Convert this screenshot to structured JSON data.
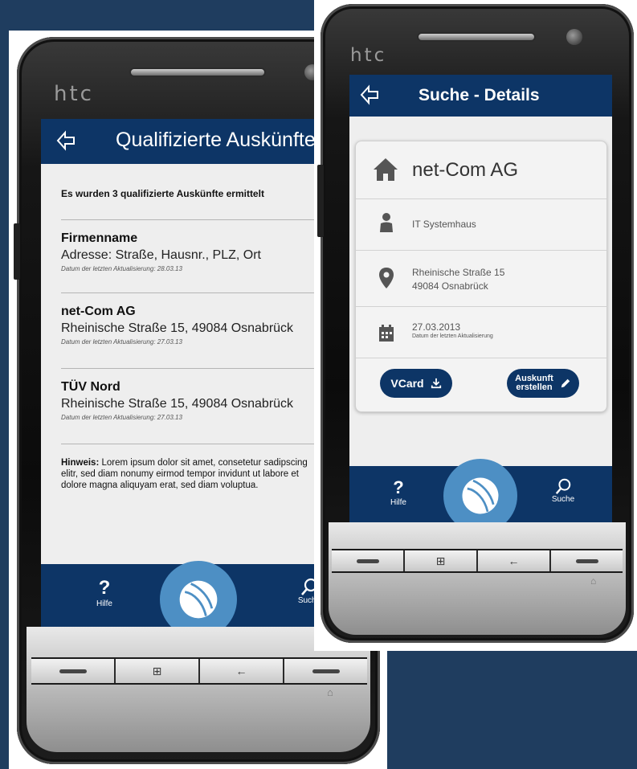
{
  "phone_left": {
    "brand": "htc",
    "screen": {
      "title": "Qualifizierte Auskünfte",
      "result_count": "Es wurden 3 qualifizierte Auskünfte ermittelt",
      "entries": [
        {
          "name": "Firmenname",
          "address": "Adresse: Straße, Hausnr., PLZ, Ort",
          "updated": "Datum der letzten Aktualisierung: 28.03.13"
        },
        {
          "name": "net-Com AG",
          "address": "Rheinische Straße 15, 49084 Osnabrück",
          "updated": "Datum der letzten Aktualisierung: 27.03.13"
        },
        {
          "name": "TÜV Nord",
          "address": "Rheinische Straße 15, 49084 Osnabrück",
          "updated": "Datum der letzten Aktualisierung: 27.03.13"
        }
      ],
      "hint_label": "Hinweis:",
      "hint_text": " Lorem ipsum dolor sit amet, consetetur sadipscing elitr, sed diam nonumy eirmod tempor invidunt ut labore et dolore magna aliquyam erat, sed diam voluptua.",
      "nav_help": "Hilfe",
      "nav_help_glyph": "?",
      "nav_search": "Suche"
    }
  },
  "phone_right": {
    "brand": "htc",
    "screen": {
      "title": "Suche - Details",
      "company": "net-Com AG",
      "category": "IT Systemhaus",
      "street": "Rheinische Straße 15",
      "city": "49084 Osnabrück",
      "date": "27.03.2013",
      "date_caption": "Datum der letzten Aktualisierung",
      "vcard_label": "VCard",
      "request_label_1": "Auskunft",
      "request_label_2": "erstellen",
      "nav_help": "Hilfe",
      "nav_help_glyph": "?",
      "nav_search": "Suche"
    }
  },
  "icons": {
    "back": "back-arrow-icon",
    "home": "house-icon",
    "person": "person-icon",
    "location": "map-pin-icon",
    "calendar": "calendar-icon",
    "download": "download-icon",
    "edit": "pencil-icon",
    "search": "magnifier-icon",
    "logo": "ball-logo-icon"
  },
  "colors": {
    "background": "#1f3d5f",
    "bar": "#0d3566",
    "logo": "#4d8fc4",
    "screen": "#eeeeee"
  }
}
